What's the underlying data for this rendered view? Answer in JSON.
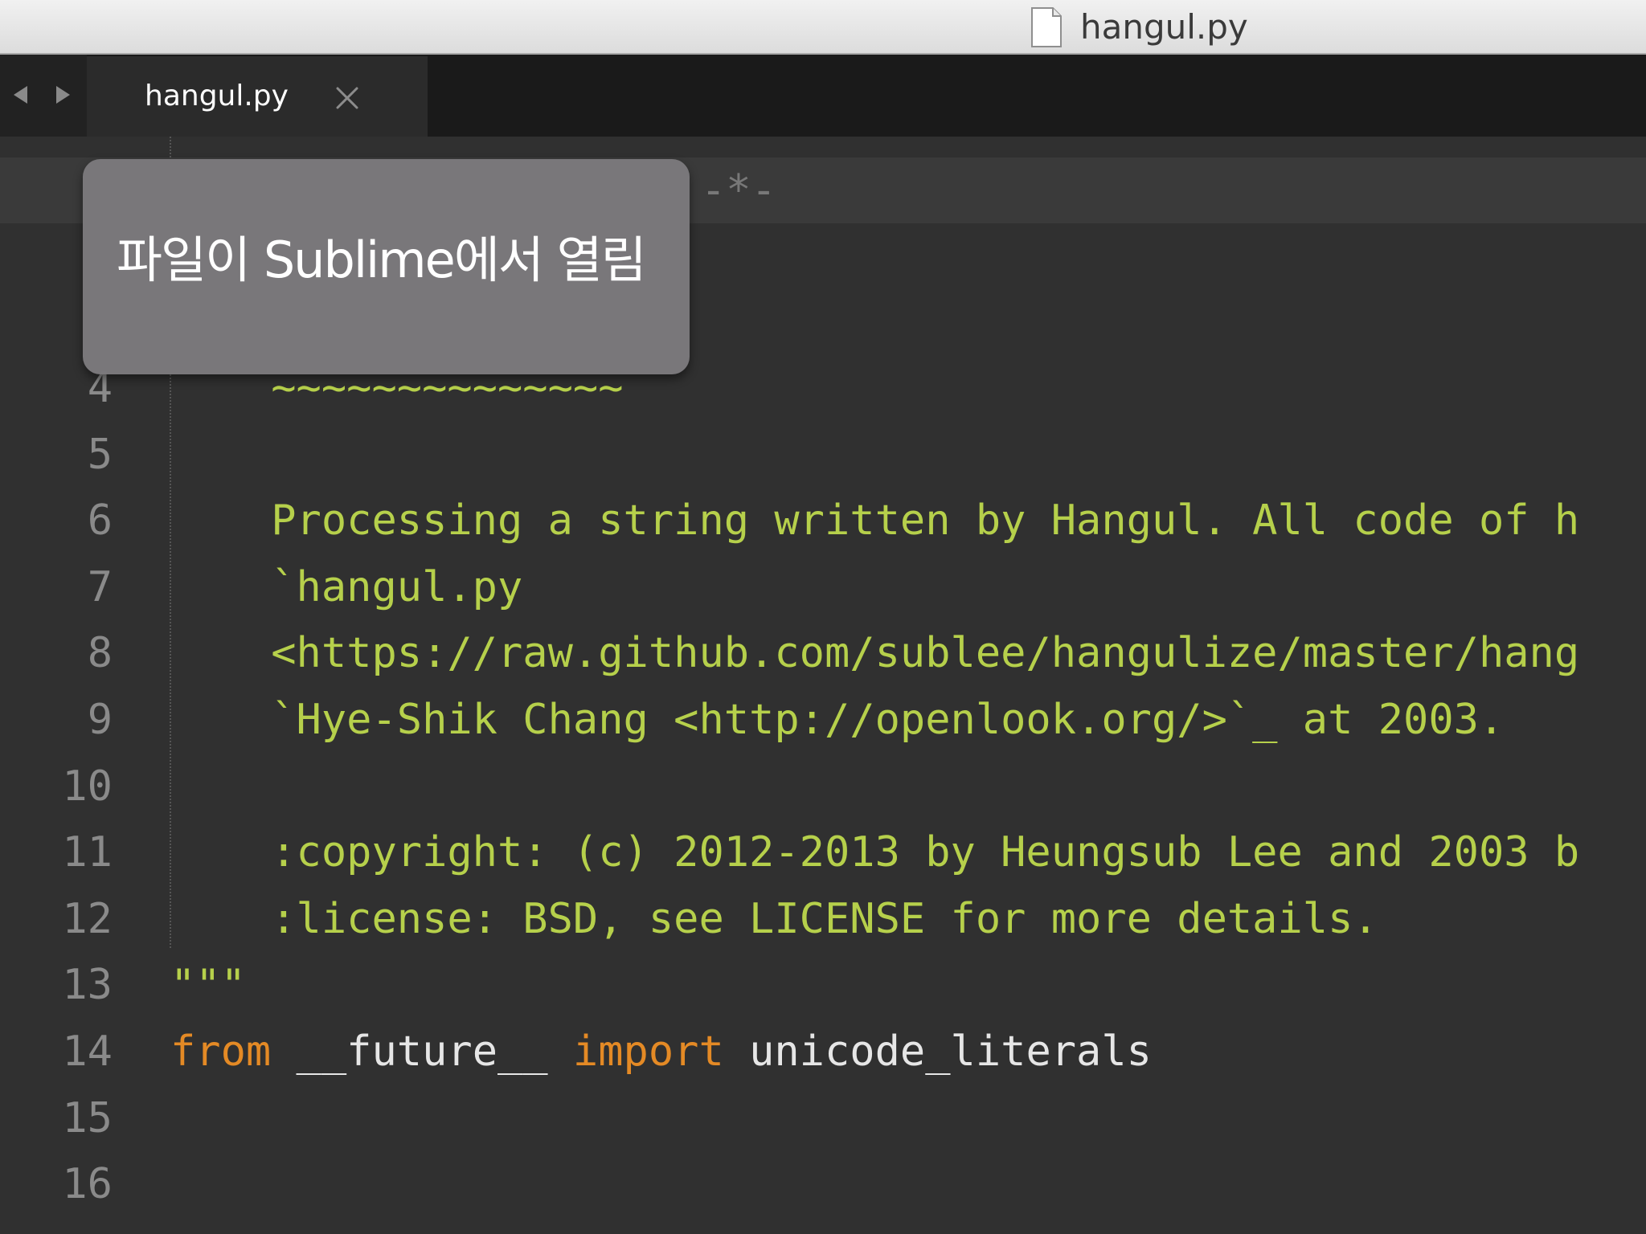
{
  "window": {
    "title": "hangul.py",
    "title_icon": "document-icon"
  },
  "tabbar": {
    "back_icon": "back-arrow-icon",
    "forward_icon": "forward-arrow-icon",
    "tabs": [
      {
        "label": "hangul.py",
        "close_icon": "close-icon"
      }
    ]
  },
  "overlay": {
    "text": "파일이 Sublime에서 열림"
  },
  "editor": {
    "first_line_visible_fragment": "-*-",
    "lines": [
      {
        "number": "4",
        "segments": [
          {
            "cls": "c-str",
            "text": "    ~~~~~~~~~~~~~~"
          }
        ]
      },
      {
        "number": "5",
        "segments": []
      },
      {
        "number": "6",
        "segments": [
          {
            "cls": "c-str",
            "text": "    Processing a string written by Hangul. All code of h"
          }
        ]
      },
      {
        "number": "7",
        "segments": [
          {
            "cls": "c-str",
            "text": "    `hangul.py"
          }
        ]
      },
      {
        "number": "8",
        "segments": [
          {
            "cls": "c-str",
            "text": "    <https://raw.github.com/sublee/hangulize/master/hang"
          }
        ]
      },
      {
        "number": "9",
        "segments": [
          {
            "cls": "c-str",
            "text": "    `Hye-Shik Chang <http://openlook.org/>`_ at 2003."
          }
        ]
      },
      {
        "number": "10",
        "segments": []
      },
      {
        "number": "11",
        "segments": [
          {
            "cls": "c-str",
            "text": "    :copyright: (c) 2012-2013 by Heungsub Lee and 2003 b"
          }
        ]
      },
      {
        "number": "12",
        "segments": [
          {
            "cls": "c-str",
            "text": "    :license: BSD, see LICENSE for more details."
          }
        ]
      },
      {
        "number": "13",
        "segments": [
          {
            "cls": "c-str",
            "text": "\"\"\""
          }
        ]
      },
      {
        "number": "14",
        "segments": [
          {
            "cls": "c-kw",
            "text": "from"
          },
          {
            "cls": "c-id",
            "text": " __future__ "
          },
          {
            "cls": "c-kw",
            "text": "import"
          },
          {
            "cls": "c-id",
            "text": " unicode_literals"
          }
        ]
      },
      {
        "number": "15",
        "segments": []
      },
      {
        "number": "16",
        "segments": []
      }
    ]
  },
  "colors": {
    "string": "#b6d04b",
    "keyword": "#e48a25",
    "identifier": "#e6e6e6",
    "gutter": "#8a8a8a",
    "editor_bg": "#303030",
    "tabbar_bg": "#1a1a1a"
  }
}
